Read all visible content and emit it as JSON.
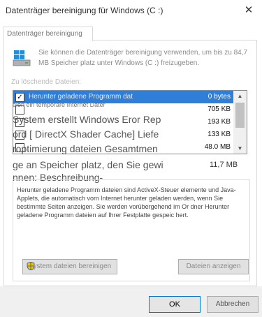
{
  "window": {
    "title": "Datenträger bereinigung für Windows (C :)",
    "close_glyph": "✕"
  },
  "tab": {
    "label": "Datenträger bereinigung"
  },
  "info": {
    "icon": "drive-icon",
    "text": "Sie können die Datenträger bereinigung verwenden, um bis zu 84,7 MB Speicher platz unter Windows (C :) freizugeben."
  },
  "files": {
    "label": "Zu löschende Dateien:",
    "rows": [
      {
        "name": "Herunter geladene Programm dat",
        "size": "0 bytes",
        "checked": true,
        "selected": true
      },
      {
        "name": "",
        "size": "705 KB",
        "checked": false,
        "selected": false
      },
      {
        "name": "",
        "size": "193 KB",
        "checked": false,
        "selected": false
      },
      {
        "name": "",
        "size": "133 KB",
        "checked": false,
        "selected": false
      },
      {
        "name": "",
        "size": "48.0 MB",
        "checked": false,
        "selected": false
      }
    ]
  },
  "overlay_lines": [
    "eien ein temporäre Internet Dater",
    "System erstellt Windows Eror Rep",
    "ord [ DirectX Shader Cache] Liefe",
    "roptimierung dateien Gesamtmen",
    "ge an Speicher platz, den Sie gewi",
    "nnen: Beschreibung-"
  ],
  "gain": {
    "value": "11,7 MB"
  },
  "description": {
    "text": "Herunter geladene Programm dateien sind ActiveX-Steuer elemente und Java-Applets, die automatisch vom Internet herunter geladen werden, wenn Sie bestimmte Seiten anzeigen. Sie werden vorübergehend im Or dner Herunter geladene Programm dateien auf Ihrer Festplatte gespeic hert."
  },
  "buttons": {
    "system": "System dateien bereinigen",
    "view_files": "Dateien anzeigen",
    "ok": "OK",
    "cancel": "Abbrechen"
  },
  "colors": {
    "selection": "#2f7fd8",
    "accent": "#0078d7"
  }
}
